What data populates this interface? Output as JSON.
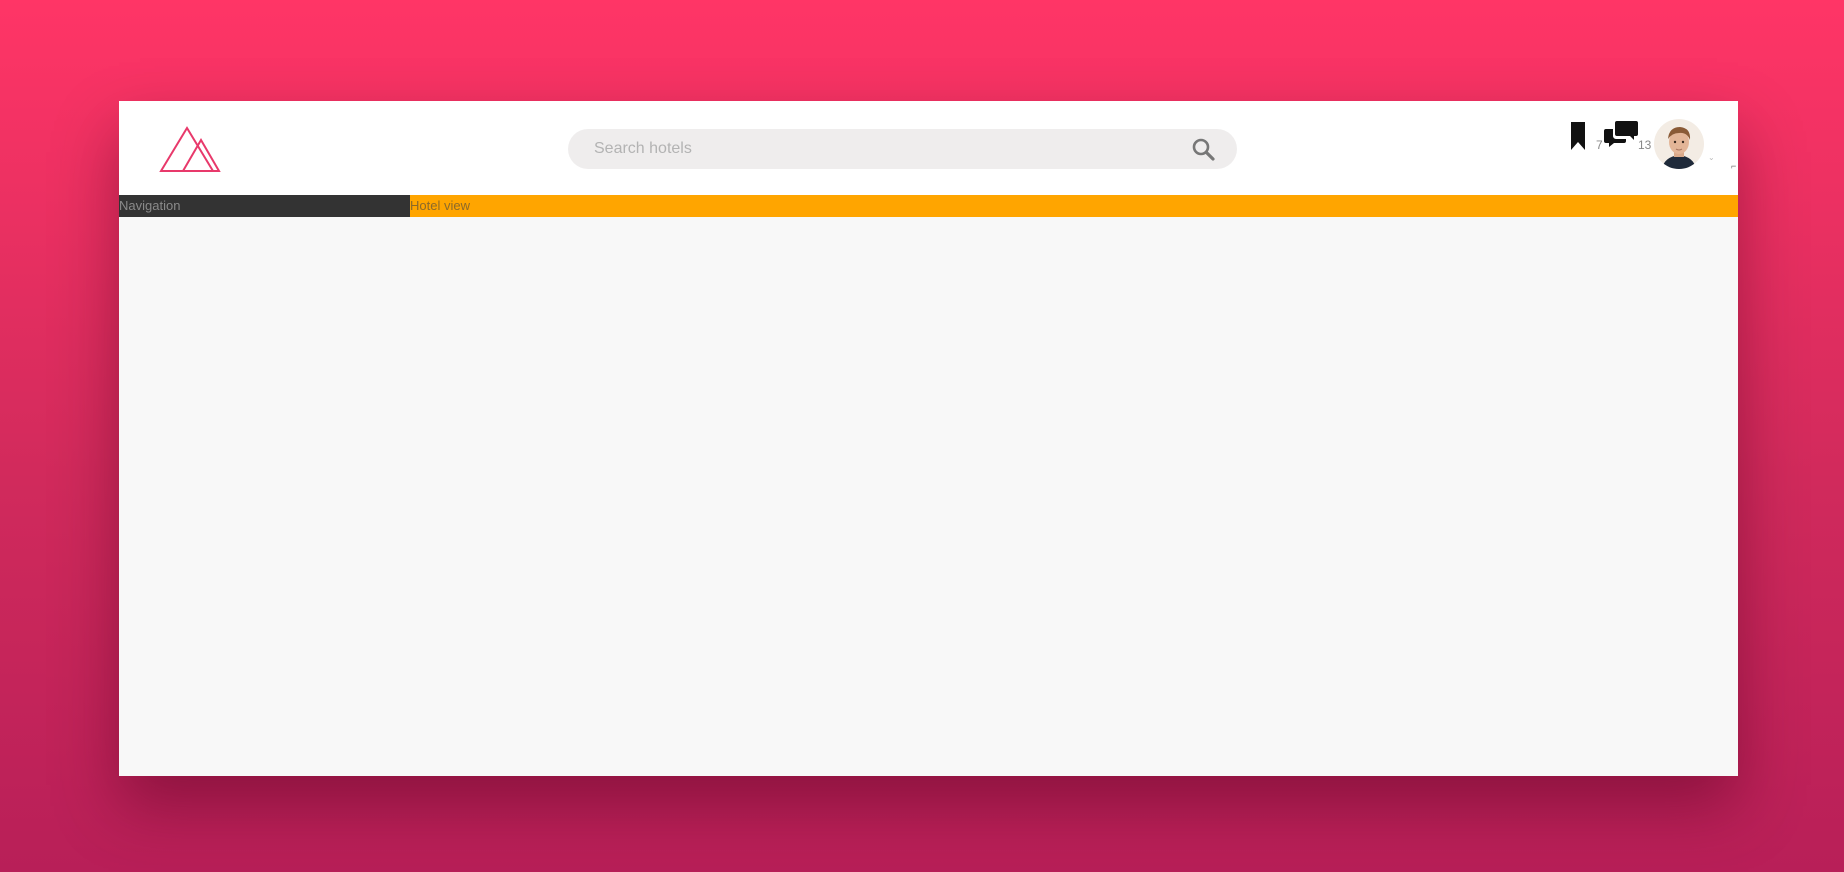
{
  "search": {
    "placeholder": "Search hotels",
    "value": ""
  },
  "header": {
    "bookmarks": {
      "icon": "bookmark-icon",
      "count": "7"
    },
    "messages": {
      "icon": "chat-icon",
      "count": "13"
    },
    "avatar_caret": "⌄",
    "edge_mark": "⌐"
  },
  "bars": {
    "navigation_label": "Navigation",
    "view_label": "Hotel view"
  },
  "colors": {
    "background_top": "#ff3566",
    "background_bottom": "#b81f58",
    "brand_accent": "#e8396b",
    "nav_bar": "#333333",
    "view_bar": "#ffa500",
    "content": "#f8f8f8"
  }
}
